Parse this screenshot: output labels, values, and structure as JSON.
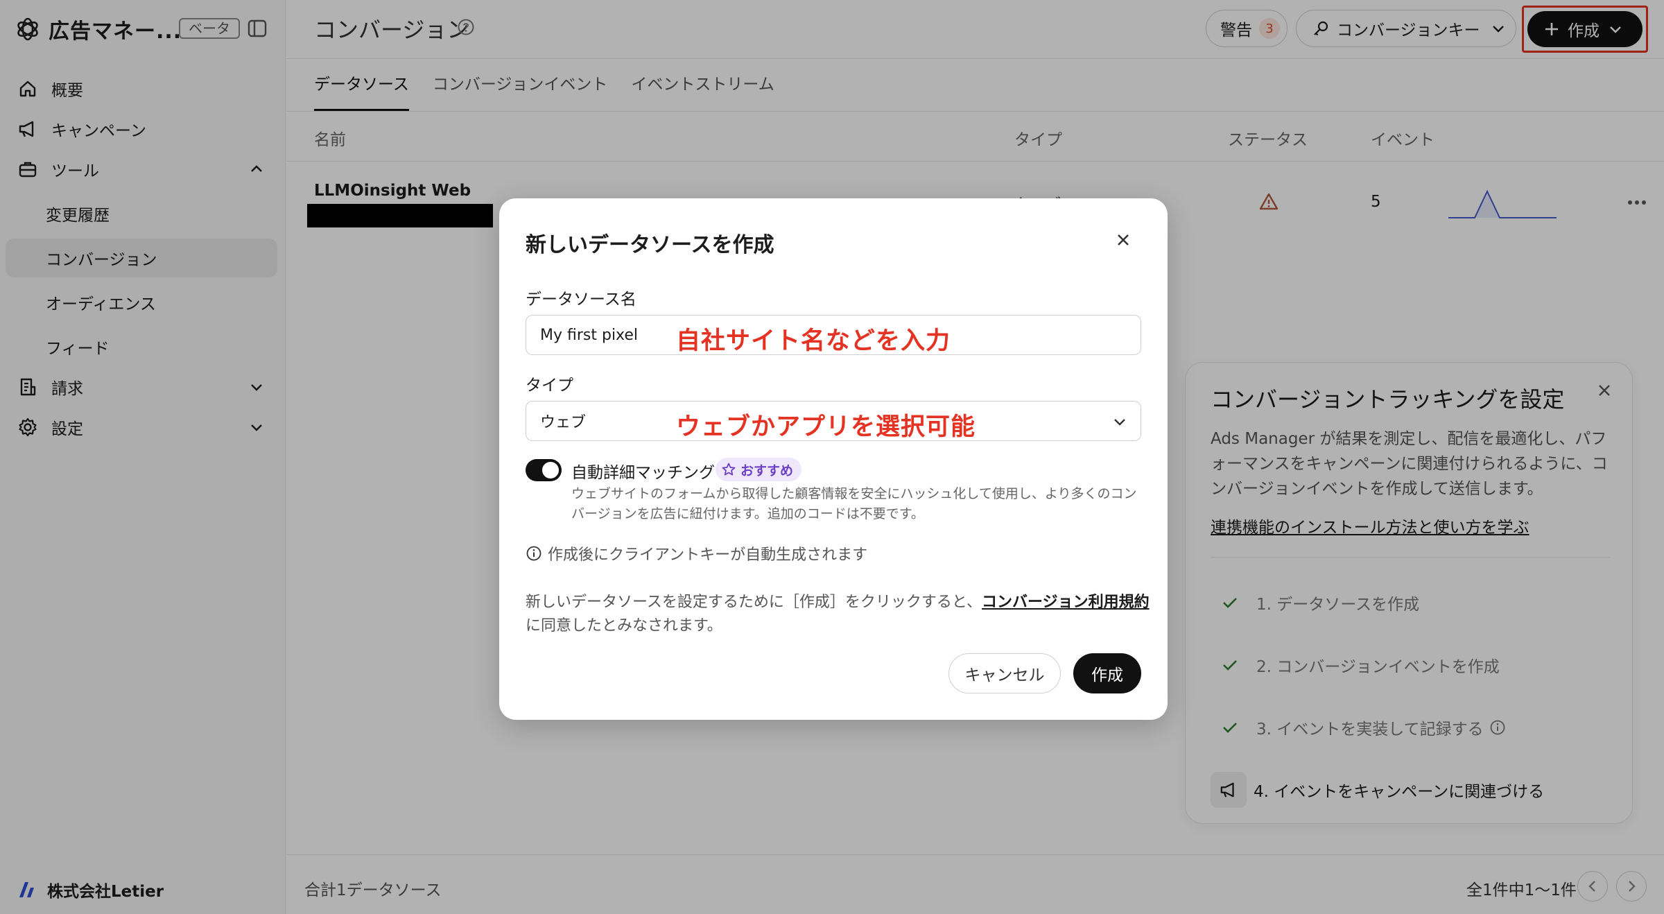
{
  "app": {
    "title": "広告マネー...",
    "beta_label": "ベータ"
  },
  "sidebar": {
    "items": [
      {
        "label": "概要"
      },
      {
        "label": "キャンペーン"
      },
      {
        "label": "ツール"
      },
      {
        "label": "請求"
      },
      {
        "label": "設定"
      }
    ],
    "tools_children": [
      {
        "label": "変更履歴"
      },
      {
        "label": "コンバージョン"
      },
      {
        "label": "オーディエンス"
      },
      {
        "label": "フィード"
      }
    ],
    "org_name": "株式会社Letier"
  },
  "header": {
    "title": "コンバージョン",
    "warn_label": "警告",
    "warn_count": "3",
    "key_label": "コンバージョンキー",
    "create_label": "作成"
  },
  "tabs": [
    {
      "label": "データソース"
    },
    {
      "label": "コンバージョンイベント"
    },
    {
      "label": "イベントストリーム"
    }
  ],
  "table": {
    "columns": [
      "名前",
      "タイプ",
      "ステータス",
      "イベント"
    ],
    "rows": [
      {
        "name": "LLMOinsight Web",
        "type": "ウェブ",
        "events": "5"
      }
    ]
  },
  "footer": {
    "total": "合計1データソース",
    "range": "全1件中1〜1件"
  },
  "setup_panel": {
    "title": "コンバージョントラッキングを設定",
    "description": "Ads Manager が結果を測定し、配信を最適化し、パフォーマンスをキャンペーンに関連付けられるように、コンバージョンイベントを作成して送信します。",
    "link": "連携機能のインストール方法と使い方を学ぶ",
    "steps": [
      {
        "label": "1. データソースを作成"
      },
      {
        "label": "2. コンバージョンイベントを作成"
      },
      {
        "label": "3. イベントを実装して記録する"
      },
      {
        "label": "4. イベントをキャンペーンに関連づける"
      }
    ]
  },
  "modal": {
    "title": "新しいデータソースを作成",
    "name_label": "データソース名",
    "name_value": "My first pixel",
    "name_annotation": "自社サイト名などを入力",
    "type_label": "タイプ",
    "type_value": "ウェブ",
    "type_annotation": "ウェブかアプリを選択可能",
    "toggle_label": "自動詳細マッチング",
    "recommended_badge": "おすすめ",
    "toggle_desc": "ウェブサイトのフォームから取得した顧客情報を安全にハッシュ化して使用し、より多くのコンバージョンを広告に紐付けます。追加のコードは不要です。",
    "notice": "作成後にクライアントキーが自動生成されます",
    "terms_prefix": "新しいデータソースを設定するために［作成］をクリックすると、",
    "terms_link": "コンバージョン利用規約",
    "terms_suffix": "に同意したとみなされます。",
    "cancel_label": "キャンセル",
    "submit_label": "作成"
  },
  "colors": {
    "accent": "#111111",
    "annotation_red": "#e53323",
    "badge_purple": "#6c3fc5",
    "warn_orange": "#d94c2b",
    "check_green": "#2e7d32"
  }
}
